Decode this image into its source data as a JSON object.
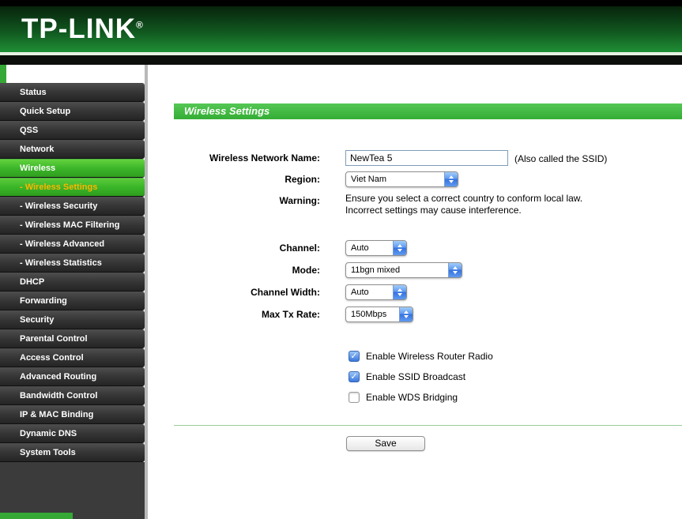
{
  "header": {
    "logo": "TP-LINK",
    "registered": "®"
  },
  "sidebar": {
    "items": [
      {
        "label": "Status"
      },
      {
        "label": "Quick Setup"
      },
      {
        "label": "QSS"
      },
      {
        "label": "Network"
      },
      {
        "label": "Wireless"
      },
      {
        "label": "- Wireless Settings"
      },
      {
        "label": "- Wireless Security"
      },
      {
        "label": "- Wireless MAC Filtering"
      },
      {
        "label": "- Wireless Advanced"
      },
      {
        "label": "- Wireless Statistics"
      },
      {
        "label": "DHCP"
      },
      {
        "label": "Forwarding"
      },
      {
        "label": "Security"
      },
      {
        "label": "Parental Control"
      },
      {
        "label": "Access Control"
      },
      {
        "label": "Advanced Routing"
      },
      {
        "label": "Bandwidth Control"
      },
      {
        "label": "IP & MAC Binding"
      },
      {
        "label": "Dynamic DNS"
      },
      {
        "label": "System Tools"
      }
    ]
  },
  "main": {
    "title": "Wireless Settings",
    "form": {
      "network_name": {
        "label": "Wireless Network Name:",
        "value": "NewTea 5",
        "note": "(Also called the SSID)"
      },
      "region": {
        "label": "Region:",
        "value": "Viet Nam"
      },
      "warning": {
        "label": "Warning:",
        "line1": "Ensure you select a correct country to conform local law.",
        "line2": "Incorrect settings may cause interference."
      },
      "channel": {
        "label": "Channel:",
        "value": "Auto"
      },
      "mode": {
        "label": "Mode:",
        "value": "11bgn mixed"
      },
      "channel_width": {
        "label": "Channel Width:",
        "value": "Auto"
      },
      "max_tx_rate": {
        "label": "Max Tx Rate:",
        "value": "150Mbps"
      },
      "checkboxes": [
        {
          "label": "Enable Wireless Router Radio",
          "checked": true
        },
        {
          "label": "Enable SSID Broadcast",
          "checked": true
        },
        {
          "label": "Enable WDS Bridging",
          "checked": false
        }
      ],
      "save_label": "Save"
    }
  },
  "colors": {
    "header_green": "#1f8f35",
    "menu_dark": "#353535",
    "menu_active_green": "#3cb62a",
    "submenu_active_text": "#ffb400",
    "title_bar_green": "#3cb83c",
    "aqua_blue": "#3a77dd",
    "accent_green": "#35a835"
  }
}
